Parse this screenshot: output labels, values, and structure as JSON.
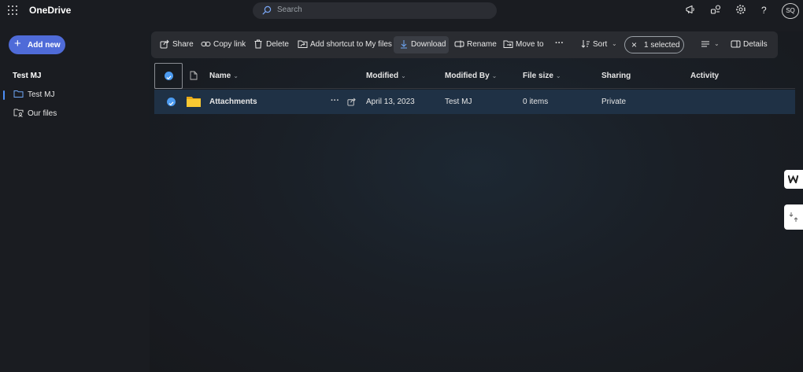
{
  "app": {
    "brand": "OneDrive"
  },
  "search": {
    "placeholder": "Search"
  },
  "topbar": {
    "icons": [
      "megaphone-icon",
      "people-connect-icon",
      "gear-icon",
      "help-icon"
    ],
    "help_glyph": "?",
    "avatar_initials": "SQ"
  },
  "sidebar": {
    "add_new_label": "Add new",
    "heading": "Test MJ",
    "items": [
      {
        "label": "Test MJ",
        "icon": "folder-icon",
        "active": true
      },
      {
        "label": "Our files",
        "icon": "shared-folder-icon",
        "active": false
      }
    ]
  },
  "commandbar": {
    "share": "Share",
    "copy_link": "Copy link",
    "delete": "Delete",
    "add_shortcut": "Add shortcut to My files",
    "download": "Download",
    "rename": "Rename",
    "move_to": "Move to",
    "more": "···",
    "sort": "Sort",
    "selected": "1 selected",
    "details": "Details"
  },
  "table": {
    "columns": [
      "Name",
      "Modified",
      "Modified By",
      "File size",
      "Sharing",
      "Activity"
    ],
    "rows": [
      {
        "name": "Attachments",
        "modified": "April 13, 2023",
        "modified_by": "Test MJ",
        "file_size": "0 items",
        "sharing": "Private",
        "activity": "",
        "more": "···",
        "selected": true
      }
    ]
  },
  "colors": {
    "accent": "#4f6bd8",
    "check_blue": "#4c9bf0",
    "folder_yellow": "#f4c430",
    "row_selected": "#1f3145",
    "background": "#1a1c21"
  }
}
